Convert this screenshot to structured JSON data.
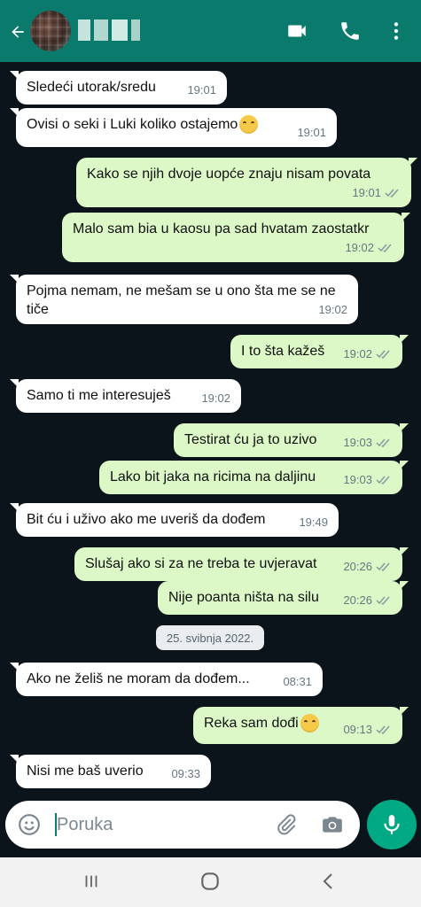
{
  "header": {
    "back_icon": "back-arrow-icon",
    "avatar_icon": "avatar-icon",
    "video_icon": "video-call-icon",
    "phone_icon": "voice-call-icon",
    "menu_icon": "more-vert-icon"
  },
  "messages": [
    {
      "side": "in",
      "text": "Sledeći utorak/sredu",
      "time": "19:01"
    },
    {
      "side": "in",
      "text": "Ovisi o seki i Luki koliko ostajemo",
      "time": "19:01",
      "emoji": "grinning-sweat-emoji"
    },
    {
      "side": "out",
      "text": "Kako se njih dvoje uopće znaju nisam povata",
      "time": "19:01"
    },
    {
      "side": "out",
      "text": "Malo sam bia u kaosu pa sad hvatam zaostatkr",
      "time": "19:02"
    },
    {
      "side": "in",
      "text": "Pojma nemam, ne mešam se u ono šta me se ne tiče",
      "time": "19:02"
    },
    {
      "side": "out",
      "text": "I to šta kažeš",
      "time": "19:02"
    },
    {
      "side": "in",
      "text": "Samo ti me interesuješ",
      "time": "19:02"
    },
    {
      "side": "out",
      "text": "Testirat ću ja to uzivo",
      "time": "19:03"
    },
    {
      "side": "out",
      "text": "Lako bit jaka na ricima na daljinu",
      "time": "19:03"
    },
    {
      "side": "in",
      "text": "Bit ću i uživo ako me uveriš da dođem",
      "time": "19:49"
    },
    {
      "side": "out",
      "text": "Slušaj ako si za ne treba te uvjeravat",
      "time": "20:26"
    },
    {
      "side": "out",
      "text": "Nije poanta ništa na silu",
      "time": "20:26"
    },
    {
      "side": "in",
      "text": "Ako ne želiš ne moram da dođem...",
      "time": "08:31"
    },
    {
      "side": "out",
      "text": "Reka sam dođi",
      "time": "09:13",
      "emoji": "smirking-emoji"
    },
    {
      "side": "in",
      "text": "Nisi me baš uverio",
      "time": "09:33"
    }
  ],
  "date_separator": "25. svibnja 2022.",
  "composer": {
    "placeholder": "Poruka",
    "emoji_icon": "emoji-icon",
    "attach_icon": "attach-icon",
    "camera_icon": "camera-icon",
    "mic_icon": "mic-icon"
  },
  "navbar": {
    "recents_icon": "recents-icon",
    "home_icon": "home-icon",
    "back_icon": "back-icon"
  },
  "colors": {
    "header": "#0a7a6c",
    "incoming": "#ffffff",
    "outgoing": "#dcf8c6",
    "background": "#0b141a",
    "accent": "#00a884"
  }
}
